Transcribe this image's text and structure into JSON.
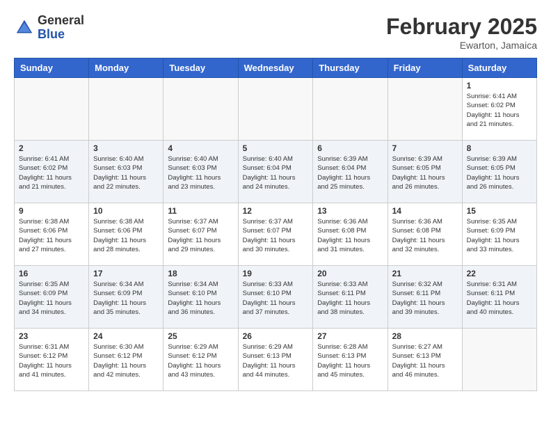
{
  "logo": {
    "general": "General",
    "blue": "Blue"
  },
  "title": "February 2025",
  "location": "Ewarton, Jamaica",
  "days_header": [
    "Sunday",
    "Monday",
    "Tuesday",
    "Wednesday",
    "Thursday",
    "Friday",
    "Saturday"
  ],
  "weeks": [
    [
      {
        "day": "",
        "info": ""
      },
      {
        "day": "",
        "info": ""
      },
      {
        "day": "",
        "info": ""
      },
      {
        "day": "",
        "info": ""
      },
      {
        "day": "",
        "info": ""
      },
      {
        "day": "",
        "info": ""
      },
      {
        "day": "1",
        "info": "Sunrise: 6:41 AM\nSunset: 6:02 PM\nDaylight: 11 hours\nand 21 minutes."
      }
    ],
    [
      {
        "day": "2",
        "info": "Sunrise: 6:41 AM\nSunset: 6:02 PM\nDaylight: 11 hours\nand 21 minutes."
      },
      {
        "day": "3",
        "info": "Sunrise: 6:40 AM\nSunset: 6:03 PM\nDaylight: 11 hours\nand 22 minutes."
      },
      {
        "day": "4",
        "info": "Sunrise: 6:40 AM\nSunset: 6:03 PM\nDaylight: 11 hours\nand 23 minutes."
      },
      {
        "day": "5",
        "info": "Sunrise: 6:40 AM\nSunset: 6:04 PM\nDaylight: 11 hours\nand 24 minutes."
      },
      {
        "day": "6",
        "info": "Sunrise: 6:39 AM\nSunset: 6:04 PM\nDaylight: 11 hours\nand 25 minutes."
      },
      {
        "day": "7",
        "info": "Sunrise: 6:39 AM\nSunset: 6:05 PM\nDaylight: 11 hours\nand 26 minutes."
      },
      {
        "day": "8",
        "info": "Sunrise: 6:39 AM\nSunset: 6:05 PM\nDaylight: 11 hours\nand 26 minutes."
      }
    ],
    [
      {
        "day": "9",
        "info": "Sunrise: 6:38 AM\nSunset: 6:06 PM\nDaylight: 11 hours\nand 27 minutes."
      },
      {
        "day": "10",
        "info": "Sunrise: 6:38 AM\nSunset: 6:06 PM\nDaylight: 11 hours\nand 28 minutes."
      },
      {
        "day": "11",
        "info": "Sunrise: 6:37 AM\nSunset: 6:07 PM\nDaylight: 11 hours\nand 29 minutes."
      },
      {
        "day": "12",
        "info": "Sunrise: 6:37 AM\nSunset: 6:07 PM\nDaylight: 11 hours\nand 30 minutes."
      },
      {
        "day": "13",
        "info": "Sunrise: 6:36 AM\nSunset: 6:08 PM\nDaylight: 11 hours\nand 31 minutes."
      },
      {
        "day": "14",
        "info": "Sunrise: 6:36 AM\nSunset: 6:08 PM\nDaylight: 11 hours\nand 32 minutes."
      },
      {
        "day": "15",
        "info": "Sunrise: 6:35 AM\nSunset: 6:09 PM\nDaylight: 11 hours\nand 33 minutes."
      }
    ],
    [
      {
        "day": "16",
        "info": "Sunrise: 6:35 AM\nSunset: 6:09 PM\nDaylight: 11 hours\nand 34 minutes."
      },
      {
        "day": "17",
        "info": "Sunrise: 6:34 AM\nSunset: 6:09 PM\nDaylight: 11 hours\nand 35 minutes."
      },
      {
        "day": "18",
        "info": "Sunrise: 6:34 AM\nSunset: 6:10 PM\nDaylight: 11 hours\nand 36 minutes."
      },
      {
        "day": "19",
        "info": "Sunrise: 6:33 AM\nSunset: 6:10 PM\nDaylight: 11 hours\nand 37 minutes."
      },
      {
        "day": "20",
        "info": "Sunrise: 6:33 AM\nSunset: 6:11 PM\nDaylight: 11 hours\nand 38 minutes."
      },
      {
        "day": "21",
        "info": "Sunrise: 6:32 AM\nSunset: 6:11 PM\nDaylight: 11 hours\nand 39 minutes."
      },
      {
        "day": "22",
        "info": "Sunrise: 6:31 AM\nSunset: 6:11 PM\nDaylight: 11 hours\nand 40 minutes."
      }
    ],
    [
      {
        "day": "23",
        "info": "Sunrise: 6:31 AM\nSunset: 6:12 PM\nDaylight: 11 hours\nand 41 minutes."
      },
      {
        "day": "24",
        "info": "Sunrise: 6:30 AM\nSunset: 6:12 PM\nDaylight: 11 hours\nand 42 minutes."
      },
      {
        "day": "25",
        "info": "Sunrise: 6:29 AM\nSunset: 6:12 PM\nDaylight: 11 hours\nand 43 minutes."
      },
      {
        "day": "26",
        "info": "Sunrise: 6:29 AM\nSunset: 6:13 PM\nDaylight: 11 hours\nand 44 minutes."
      },
      {
        "day": "27",
        "info": "Sunrise: 6:28 AM\nSunset: 6:13 PM\nDaylight: 11 hours\nand 45 minutes."
      },
      {
        "day": "28",
        "info": "Sunrise: 6:27 AM\nSunset: 6:13 PM\nDaylight: 11 hours\nand 46 minutes."
      },
      {
        "day": "",
        "info": ""
      }
    ]
  ]
}
